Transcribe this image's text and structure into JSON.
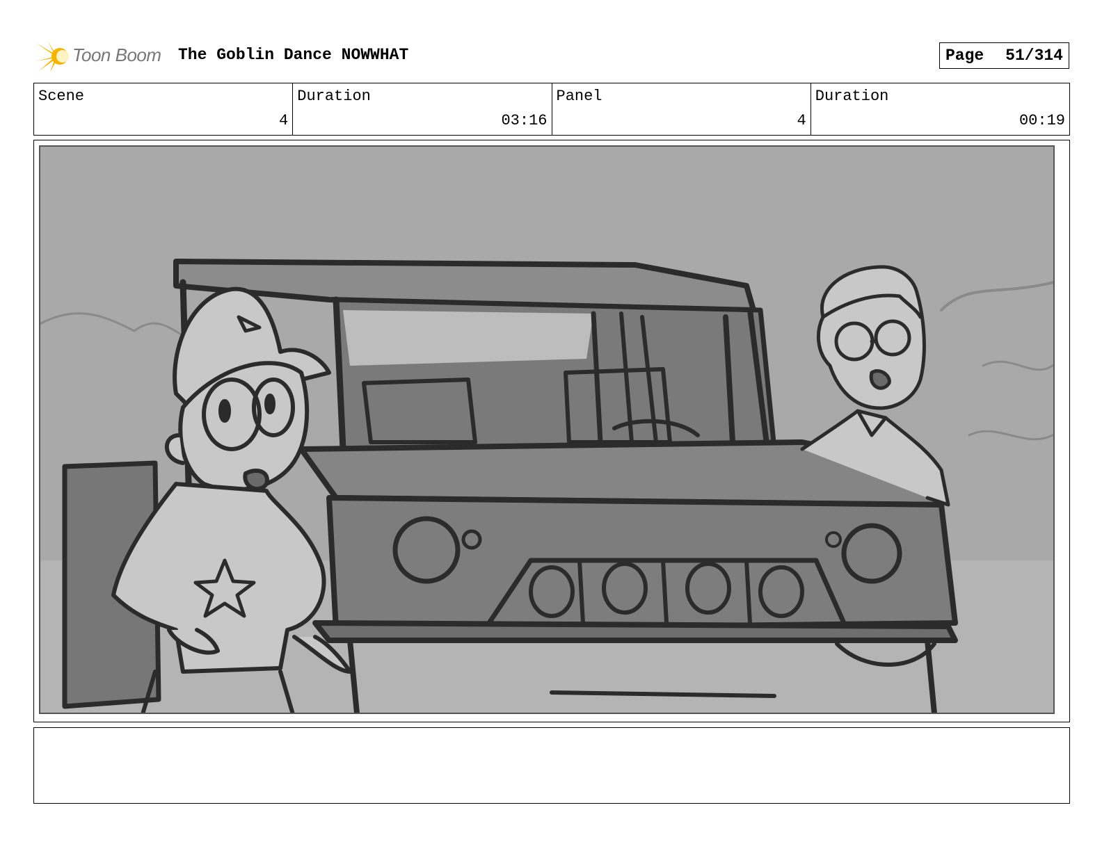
{
  "header": {
    "logo_text": "Toon Boom",
    "project_title": "The Goblin Dance NOWWHAT",
    "page_label": "Page",
    "page_value": "51/314"
  },
  "info": {
    "scene_label": "Scene",
    "scene_value": "4",
    "scene_duration_label": "Duration",
    "scene_duration_value": "03:16",
    "panel_label": "Panel",
    "panel_value": "4",
    "panel_duration_label": "Duration",
    "panel_duration_value": "00:19"
  },
  "caption": {
    "text": ""
  },
  "colors": {
    "logo_yellow": "#f5b400",
    "sketch_line": "#2b2b2b",
    "sky": "#a8a8a8",
    "vehicle": "#7d7d7d",
    "character_fill": "#c8c8c8"
  }
}
